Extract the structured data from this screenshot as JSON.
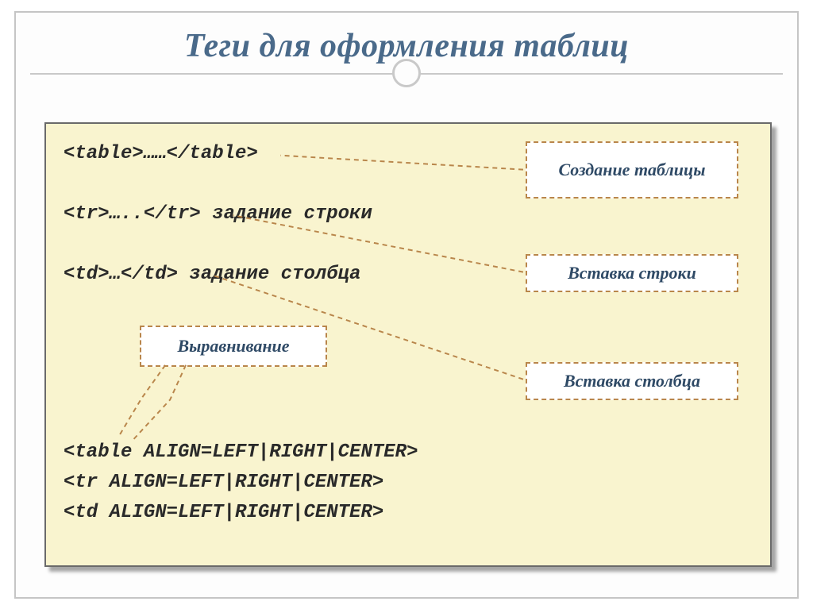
{
  "title": "Теги для оформления таблиц",
  "code": {
    "line1": "<table>……</table>",
    "line2": "<tr>…..</tr> задание строки",
    "line3": "<td>…</td> задание столбца",
    "line4": "<table ALIGN=LEFT|RIGHT|CENTER>",
    "line5": "<tr ALIGN=LEFT|RIGHT|CENTER>",
    "line6": "<td ALIGN=LEFT|RIGHT|CENTER>"
  },
  "callouts": {
    "create": "Создание таблицы",
    "row": "Вставка строки",
    "col": "Вставка столбца",
    "align": "Выравнивание"
  }
}
